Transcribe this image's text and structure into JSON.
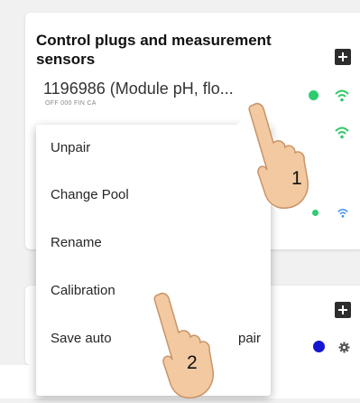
{
  "section": {
    "title": "Control plugs and measurement sensors"
  },
  "device": {
    "name": "1196986 (Module pH, flo...",
    "subtitle": "OFF 000 FIN CA"
  },
  "context_menu": {
    "items": [
      {
        "label": "Unpair"
      },
      {
        "label": "Change Pool"
      },
      {
        "label": "Rename"
      },
      {
        "label": "Calibration"
      },
      {
        "label": "Save auto",
        "trailing_fragment": "pair"
      }
    ]
  },
  "annotations": {
    "step1": "1",
    "step2": "2"
  },
  "icons": {
    "add": "plus-square-icon",
    "wifi": "wifi-icon",
    "settings": "gear-icon",
    "hand": "pointing-hand-icon"
  },
  "colors": {
    "status_green": "#2ecc71",
    "wifi_green": "#32c96a",
    "wifi_blue": "#3b8ef5",
    "status_blue": "#1414d2"
  }
}
